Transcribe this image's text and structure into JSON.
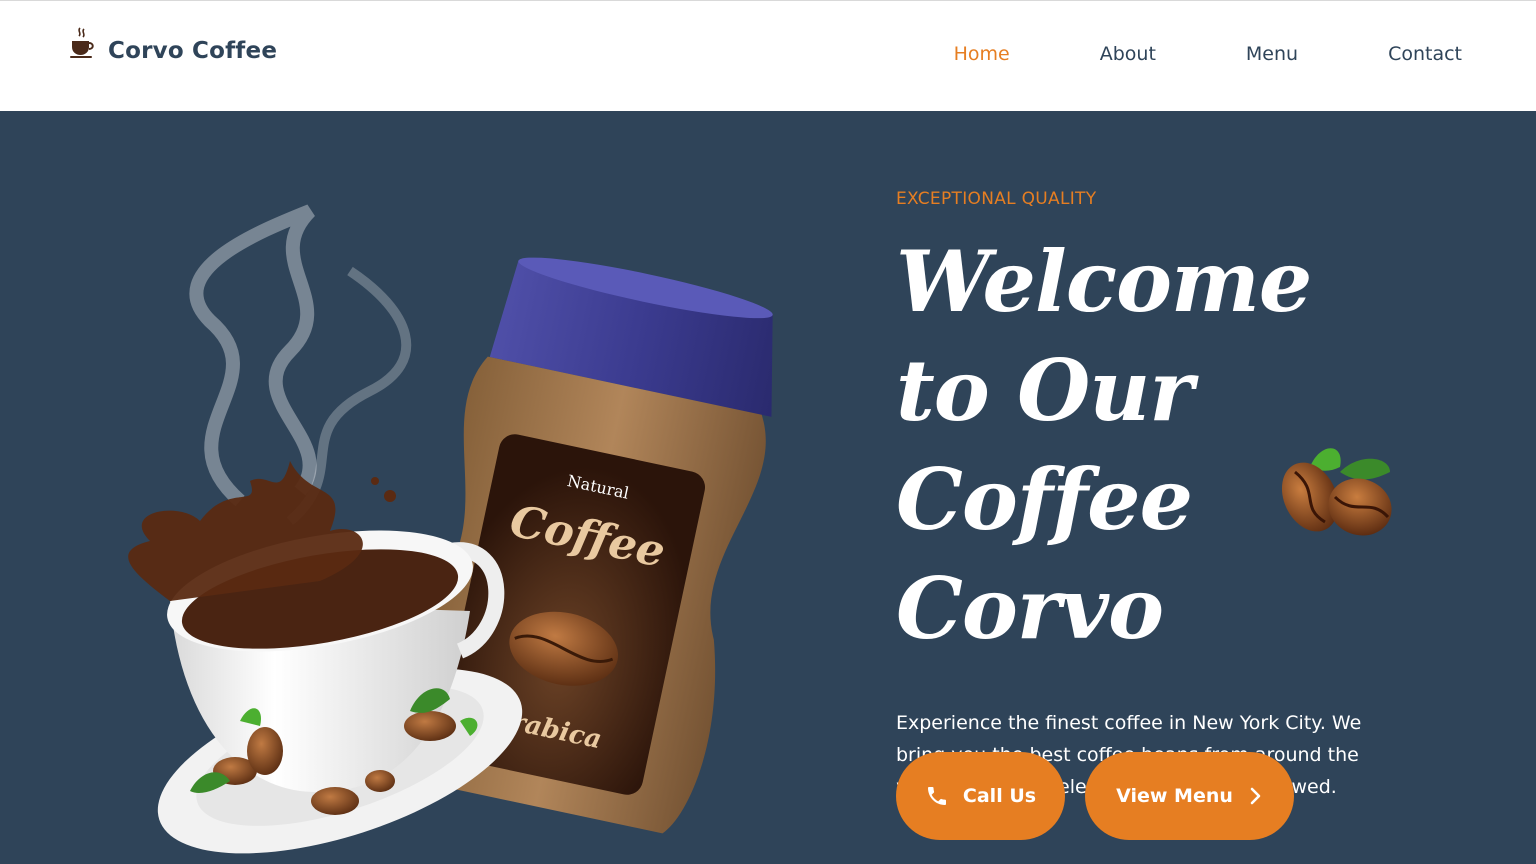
{
  "brand": {
    "name": "Corvo Coffee",
    "icon": "coffee-cup-icon"
  },
  "nav": {
    "items": [
      {
        "label": "Home",
        "active": true
      },
      {
        "label": "About",
        "active": false
      },
      {
        "label": "Menu",
        "active": false
      },
      {
        "label": "Contact",
        "active": false
      }
    ]
  },
  "hero": {
    "eyebrow": "EXCEPTIONAL QUALITY",
    "title": "Welcome to Our Coffee Corvo",
    "description": "Experience the finest coffee in New York City. We bring you the best coffee beans from around the world, carefully selected and expertly brewed.",
    "jar_label": {
      "top": "Natural",
      "name": "Coffee",
      "variety": "Arabica"
    },
    "buttons": {
      "call": {
        "label": "Call Us",
        "icon": "phone-icon"
      },
      "menu": {
        "label": "View Menu",
        "icon": "chevron-right-icon"
      }
    }
  },
  "colors": {
    "accent": "#e67e22",
    "hero_bg": "#2f4459",
    "header_bg": "#ffffff",
    "text_dark": "#2f4459"
  }
}
